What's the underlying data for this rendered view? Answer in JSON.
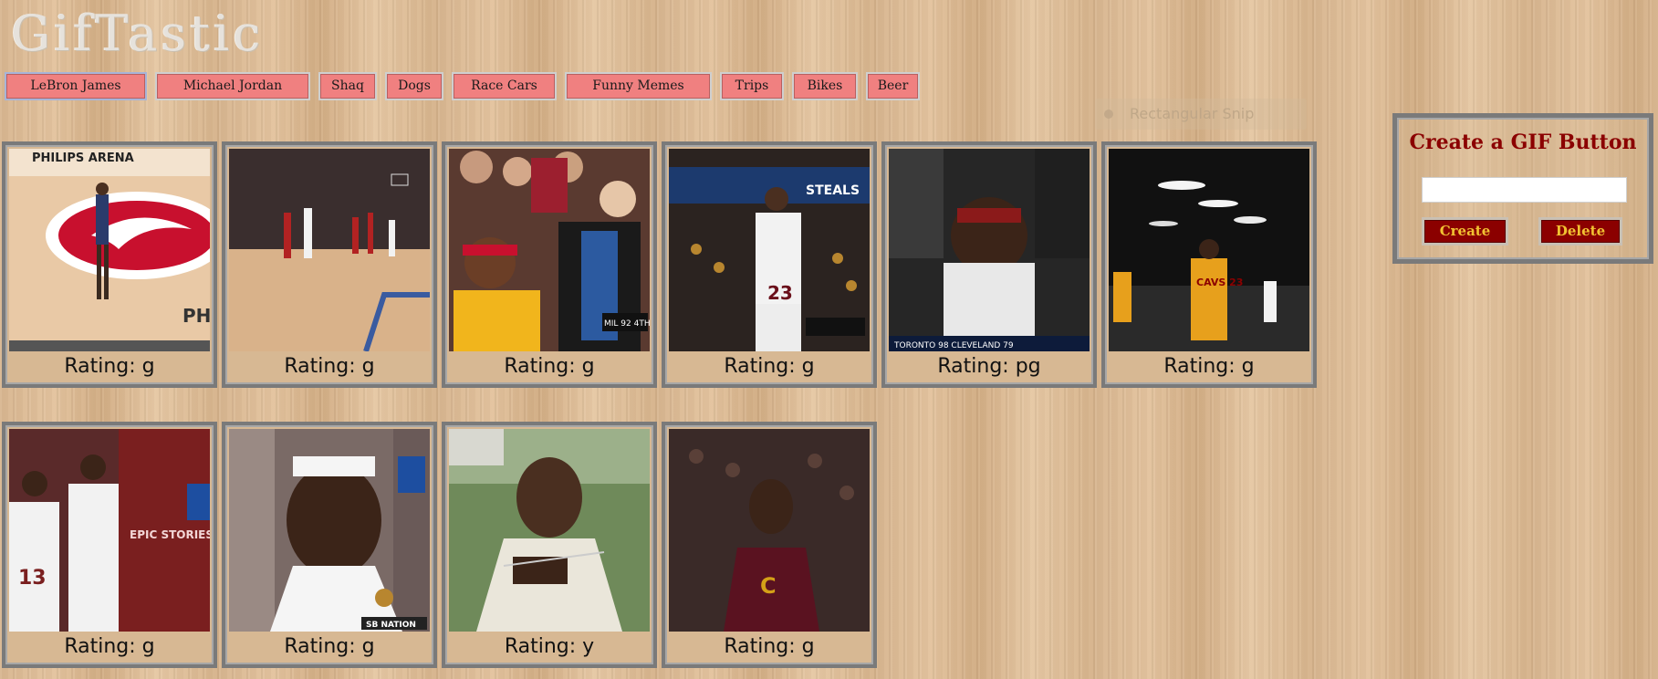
{
  "app": {
    "title": "GifTastic"
  },
  "topics": [
    {
      "label": "LeBron James"
    },
    {
      "label": "Michael Jordan"
    },
    {
      "label": "Shaq"
    },
    {
      "label": "Dogs"
    },
    {
      "label": "Race Cars"
    },
    {
      "label": "Funny Memes"
    },
    {
      "label": "Trips"
    },
    {
      "label": "Bikes"
    },
    {
      "label": "Beer"
    }
  ],
  "overlay": {
    "snip_label": "Rectangular Snip"
  },
  "gifs": [
    {
      "rating": "Rating: g",
      "caption": "PHILIPS ARENA"
    },
    {
      "rating": "Rating: g"
    },
    {
      "rating": "Rating: g",
      "scoreboard": "MIL 92 4TH"
    },
    {
      "rating": "Rating: g",
      "caption": "STEALS"
    },
    {
      "rating": "Rating: pg",
      "scoreboard": "TORONTO 98 CLEVELAND 79"
    },
    {
      "rating": "Rating: g",
      "caption": "CAVS 23"
    },
    {
      "rating": "Rating: g",
      "caption": "EPIC STORIES"
    },
    {
      "rating": "Rating: g",
      "caption": "SB NATION"
    },
    {
      "rating": "Rating: y"
    },
    {
      "rating": "Rating: g"
    }
  ],
  "create_panel": {
    "title": "Create a GIF Button",
    "input_value": "",
    "input_placeholder": "",
    "create_label": "Create",
    "delete_label": "Delete"
  },
  "colors": {
    "topic_button": "#f08080",
    "panel_button": "#8b0000",
    "panel_button_text": "#f1c232",
    "panel_title": "#8b0000",
    "frame": "#7a7a7a"
  }
}
